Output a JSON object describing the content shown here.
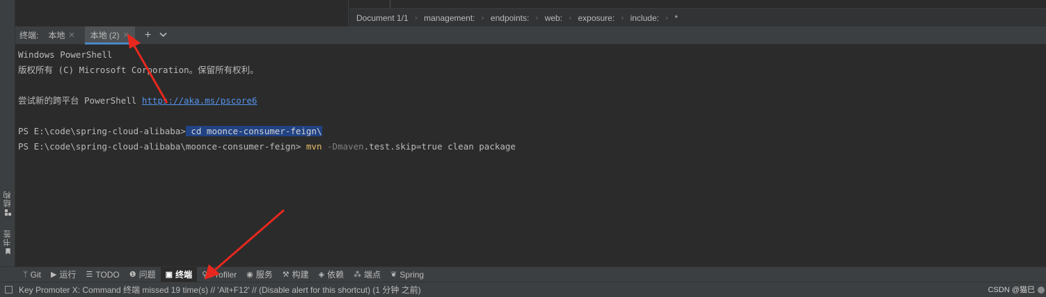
{
  "breadcrumb": {
    "items": [
      "Document 1/1",
      "management:",
      "endpoints:",
      "web:",
      "exposure:",
      "include:",
      "*"
    ],
    "separator": "›"
  },
  "left_tools": [
    {
      "label": "结构",
      "icon": "structure-icon"
    },
    {
      "label": "书签",
      "icon": "bookmark-icon"
    }
  ],
  "terminal": {
    "title": "终端:",
    "tabs": [
      {
        "label": "本地",
        "active": false
      },
      {
        "label": "本地 (2)",
        "active": true
      }
    ],
    "add_label": "+",
    "more_label": "⌄",
    "lines": {
      "l1": "Windows PowerShell",
      "l2": "版权所有 (C) Microsoft Corporation。保留所有权利。",
      "l4_prefix": "尝试新的跨平台 PowerShell ",
      "l4_link": "https://aka.ms/pscore6",
      "l6_prompt": "PS E:\\code\\spring-cloud-alibaba>",
      "l6_cmd": " cd mooncе-consumer-feign\\",
      "l7_prompt": "PS E:\\code\\spring-cloud-alibaba\\moonce-consumer-feign> ",
      "l7_mvn": "mvn",
      "l7_flag": " -Dmaven",
      "l7_rest": ".test.skip=true clean package"
    }
  },
  "tool_windows": [
    {
      "label": "Git",
      "icon": "git-branch-icon",
      "glyph": "ᛘ"
    },
    {
      "label": "运行",
      "icon": "run-icon",
      "glyph": "▶"
    },
    {
      "label": "TODO",
      "icon": "todo-list-icon",
      "glyph": "☰"
    },
    {
      "label": "问题",
      "icon": "problems-icon",
      "glyph": "❶"
    },
    {
      "label": "终端",
      "icon": "terminal-icon",
      "glyph": "▣",
      "active": true
    },
    {
      "label": "Profiler",
      "icon": "profiler-icon",
      "glyph": "⚲"
    },
    {
      "label": "服务",
      "icon": "services-icon",
      "glyph": "◉"
    },
    {
      "label": "构建",
      "icon": "build-hammer-icon",
      "glyph": "⚒"
    },
    {
      "label": "依赖",
      "icon": "dependencies-icon",
      "glyph": "◈"
    },
    {
      "label": "端点",
      "icon": "endpoints-icon",
      "glyph": "⁂"
    },
    {
      "label": "Spring",
      "icon": "spring-leaf-icon",
      "glyph": "❦"
    }
  ],
  "status": {
    "message": "Key Promoter X: Command 终端 missed 19 time(s) // 'Alt+F12' // (Disable alert for this shortcut) (1 分钟 之前)",
    "watermark": "CSDN @猫巳"
  },
  "colors": {
    "accent": "#4a88c7",
    "annotation": "#e8281e",
    "link": "#5394ec",
    "selection": "#214283"
  }
}
